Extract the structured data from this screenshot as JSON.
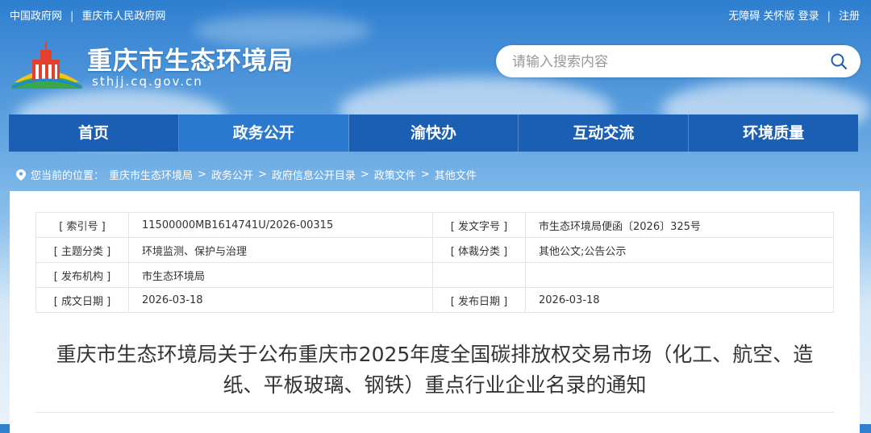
{
  "topbar": {
    "links_left": [
      "中国政府网",
      "重庆市人民政府网"
    ],
    "links_right": [
      "无障碍",
      "关怀版",
      "登录",
      "注册"
    ]
  },
  "header": {
    "site_name": "重庆市生态环境局",
    "domain": "sthjj.cq.gov.cn",
    "search_placeholder": "请输入搜索内容"
  },
  "nav": {
    "items": [
      "首页",
      "政务公开",
      "渝快办",
      "互动交流",
      "环境质量"
    ],
    "active_index": 1
  },
  "breadcrumb": {
    "prefix": "您当前的位置：",
    "items": [
      "重庆市生态环境局",
      "政务公开",
      "政府信息公开目录",
      "政策文件",
      "其他文件"
    ]
  },
  "meta": {
    "index_no_label": "[ 索引号 ]",
    "index_no": "11500000MB1614741U/2026-00315",
    "doc_no_label": "[ 发文字号 ]",
    "doc_no": "市生态环境局便函〔2026〕325号",
    "topic_label": "[ 主题分类 ]",
    "topic": "环境监测、保护与治理",
    "genre_label": "[ 体裁分类 ]",
    "genre": "其他公文;公告公示",
    "org_label": "[ 发布机构 ]",
    "org": "市生态环境局",
    "written_date_label": "[ 成文日期 ]",
    "written_date": "2026-03-18",
    "publish_date_label": "[ 发布日期 ]",
    "publish_date": "2026-03-18"
  },
  "document": {
    "title_line1": "重庆市生态环境局关于公布重庆市2025年度全国碳排放权交易市场（化工、航空、造",
    "title_line2": "纸、平板玻璃、钢铁）重点行业企业名录的通知"
  },
  "colors": {
    "nav_bg": "#1a5fb4",
    "nav_active": "#2b79cf"
  }
}
